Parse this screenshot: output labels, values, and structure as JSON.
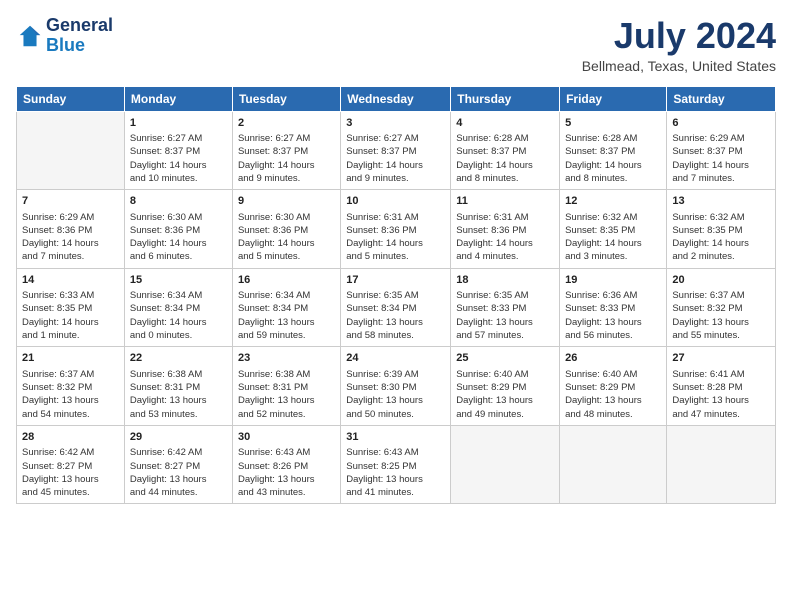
{
  "header": {
    "logo_line1": "General",
    "logo_line2": "Blue",
    "main_title": "July 2024",
    "subtitle": "Bellmead, Texas, United States"
  },
  "weekdays": [
    "Sunday",
    "Monday",
    "Tuesday",
    "Wednesday",
    "Thursday",
    "Friday",
    "Saturday"
  ],
  "weeks": [
    [
      {
        "day": "",
        "info": ""
      },
      {
        "day": "1",
        "info": "Sunrise: 6:27 AM\nSunset: 8:37 PM\nDaylight: 14 hours\nand 10 minutes."
      },
      {
        "day": "2",
        "info": "Sunrise: 6:27 AM\nSunset: 8:37 PM\nDaylight: 14 hours\nand 9 minutes."
      },
      {
        "day": "3",
        "info": "Sunrise: 6:27 AM\nSunset: 8:37 PM\nDaylight: 14 hours\nand 9 minutes."
      },
      {
        "day": "4",
        "info": "Sunrise: 6:28 AM\nSunset: 8:37 PM\nDaylight: 14 hours\nand 8 minutes."
      },
      {
        "day": "5",
        "info": "Sunrise: 6:28 AM\nSunset: 8:37 PM\nDaylight: 14 hours\nand 8 minutes."
      },
      {
        "day": "6",
        "info": "Sunrise: 6:29 AM\nSunset: 8:37 PM\nDaylight: 14 hours\nand 7 minutes."
      }
    ],
    [
      {
        "day": "7",
        "info": "Sunrise: 6:29 AM\nSunset: 8:36 PM\nDaylight: 14 hours\nand 7 minutes."
      },
      {
        "day": "8",
        "info": "Sunrise: 6:30 AM\nSunset: 8:36 PM\nDaylight: 14 hours\nand 6 minutes."
      },
      {
        "day": "9",
        "info": "Sunrise: 6:30 AM\nSunset: 8:36 PM\nDaylight: 14 hours\nand 5 minutes."
      },
      {
        "day": "10",
        "info": "Sunrise: 6:31 AM\nSunset: 8:36 PM\nDaylight: 14 hours\nand 5 minutes."
      },
      {
        "day": "11",
        "info": "Sunrise: 6:31 AM\nSunset: 8:36 PM\nDaylight: 14 hours\nand 4 minutes."
      },
      {
        "day": "12",
        "info": "Sunrise: 6:32 AM\nSunset: 8:35 PM\nDaylight: 14 hours\nand 3 minutes."
      },
      {
        "day": "13",
        "info": "Sunrise: 6:32 AM\nSunset: 8:35 PM\nDaylight: 14 hours\nand 2 minutes."
      }
    ],
    [
      {
        "day": "14",
        "info": "Sunrise: 6:33 AM\nSunset: 8:35 PM\nDaylight: 14 hours\nand 1 minute."
      },
      {
        "day": "15",
        "info": "Sunrise: 6:34 AM\nSunset: 8:34 PM\nDaylight: 14 hours\nand 0 minutes."
      },
      {
        "day": "16",
        "info": "Sunrise: 6:34 AM\nSunset: 8:34 PM\nDaylight: 13 hours\nand 59 minutes."
      },
      {
        "day": "17",
        "info": "Sunrise: 6:35 AM\nSunset: 8:34 PM\nDaylight: 13 hours\nand 58 minutes."
      },
      {
        "day": "18",
        "info": "Sunrise: 6:35 AM\nSunset: 8:33 PM\nDaylight: 13 hours\nand 57 minutes."
      },
      {
        "day": "19",
        "info": "Sunrise: 6:36 AM\nSunset: 8:33 PM\nDaylight: 13 hours\nand 56 minutes."
      },
      {
        "day": "20",
        "info": "Sunrise: 6:37 AM\nSunset: 8:32 PM\nDaylight: 13 hours\nand 55 minutes."
      }
    ],
    [
      {
        "day": "21",
        "info": "Sunrise: 6:37 AM\nSunset: 8:32 PM\nDaylight: 13 hours\nand 54 minutes."
      },
      {
        "day": "22",
        "info": "Sunrise: 6:38 AM\nSunset: 8:31 PM\nDaylight: 13 hours\nand 53 minutes."
      },
      {
        "day": "23",
        "info": "Sunrise: 6:38 AM\nSunset: 8:31 PM\nDaylight: 13 hours\nand 52 minutes."
      },
      {
        "day": "24",
        "info": "Sunrise: 6:39 AM\nSunset: 8:30 PM\nDaylight: 13 hours\nand 50 minutes."
      },
      {
        "day": "25",
        "info": "Sunrise: 6:40 AM\nSunset: 8:29 PM\nDaylight: 13 hours\nand 49 minutes."
      },
      {
        "day": "26",
        "info": "Sunrise: 6:40 AM\nSunset: 8:29 PM\nDaylight: 13 hours\nand 48 minutes."
      },
      {
        "day": "27",
        "info": "Sunrise: 6:41 AM\nSunset: 8:28 PM\nDaylight: 13 hours\nand 47 minutes."
      }
    ],
    [
      {
        "day": "28",
        "info": "Sunrise: 6:42 AM\nSunset: 8:27 PM\nDaylight: 13 hours\nand 45 minutes."
      },
      {
        "day": "29",
        "info": "Sunrise: 6:42 AM\nSunset: 8:27 PM\nDaylight: 13 hours\nand 44 minutes."
      },
      {
        "day": "30",
        "info": "Sunrise: 6:43 AM\nSunset: 8:26 PM\nDaylight: 13 hours\nand 43 minutes."
      },
      {
        "day": "31",
        "info": "Sunrise: 6:43 AM\nSunset: 8:25 PM\nDaylight: 13 hours\nand 41 minutes."
      },
      {
        "day": "",
        "info": ""
      },
      {
        "day": "",
        "info": ""
      },
      {
        "day": "",
        "info": ""
      }
    ]
  ]
}
